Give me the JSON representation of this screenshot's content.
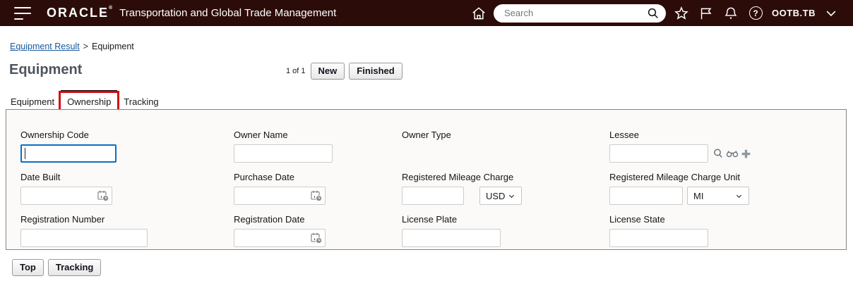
{
  "colors": {
    "header_bg": "#2c0c09",
    "focus_border": "#0670c8",
    "annotation_red": "#d40511",
    "link_blue": "#185a9f"
  },
  "icons": {
    "hamburger-icon": "≡",
    "home-icon": "⌂",
    "search-icon": "magnifier",
    "favorites-star-icon": "☆",
    "flag-icon": "⚑",
    "notifications-bell-icon": "🔔",
    "help-icon": "?",
    "chevron-down-icon": "⌄",
    "lessee-search-icon": "magnifier",
    "lessee-binoculars-icon": "binoculars",
    "lessee-add-icon": "+",
    "date-picker-icon": "calendar-clock",
    "select-chevron-icon": "⌄"
  },
  "header": {
    "brand": "ORACLE",
    "brand_mark": "®",
    "app_title": "Transportation and Global Trade Management",
    "search": {
      "placeholder": "Search",
      "value": ""
    },
    "username": "OOTB.TB"
  },
  "breadcrumb": {
    "link": "Equipment Result",
    "separator": ">",
    "current": "Equipment"
  },
  "page": {
    "title": "Equipment",
    "counter": "1 of 1",
    "actions": {
      "new": "New",
      "finished": "Finished"
    }
  },
  "tabs": {
    "equipment": "Equipment",
    "ownership": "Ownership",
    "tracking": "Tracking"
  },
  "form": {
    "ownership_code": {
      "label": "Ownership Code",
      "value": ""
    },
    "owner_name": {
      "label": "Owner Name",
      "value": ""
    },
    "owner_type": {
      "label": "Owner Type"
    },
    "lessee": {
      "label": "Lessee",
      "value": ""
    },
    "date_built": {
      "label": "Date Built",
      "value": ""
    },
    "purchase_date": {
      "label": "Purchase Date",
      "value": ""
    },
    "registered_mileage_charge": {
      "label": "Registered Mileage Charge",
      "value": "",
      "currency": "USD"
    },
    "registered_mileage_charge_unit": {
      "label": "Registered Mileage Charge Unit",
      "value": "",
      "unit": "MI"
    },
    "registration_number": {
      "label": "Registration Number",
      "value": ""
    },
    "registration_date": {
      "label": "Registration Date",
      "value": ""
    },
    "license_plate": {
      "label": "License Plate",
      "value": ""
    },
    "license_state": {
      "label": "License State",
      "value": ""
    }
  },
  "footer": {
    "top": "Top",
    "tracking": "Tracking"
  }
}
